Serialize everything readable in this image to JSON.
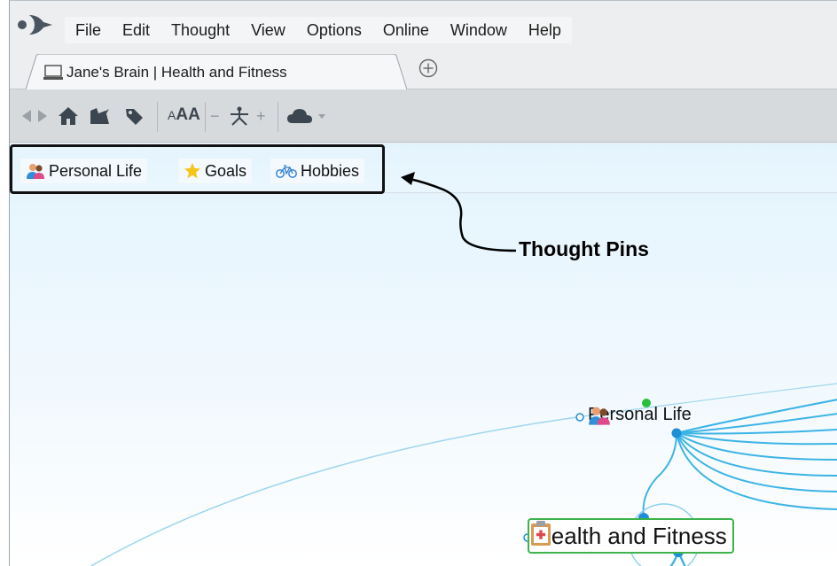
{
  "menu": {
    "items": [
      "File",
      "Edit",
      "Thought",
      "View",
      "Options",
      "Online",
      "Window",
      "Help"
    ]
  },
  "tab": {
    "title": "Jane's Brain | Health and Fitness"
  },
  "toolbar": {
    "font_size_label": "AA",
    "minus_label": "−",
    "plus_label": "+"
  },
  "pins": [
    {
      "label": "Personal Life",
      "icon": "people-icon"
    },
    {
      "label": "Goals",
      "icon": "star-icon"
    },
    {
      "label": "Hobbies",
      "icon": "bicycle-icon"
    }
  ],
  "callout": {
    "label": "Thought Pins"
  },
  "plex": {
    "active_thought": "Health and Fitness",
    "parent_thought": "Personal Life"
  },
  "colors": {
    "link": "#34b1e5",
    "accent_green": "#3cb44b",
    "node_dot": "#1c8fd6"
  }
}
